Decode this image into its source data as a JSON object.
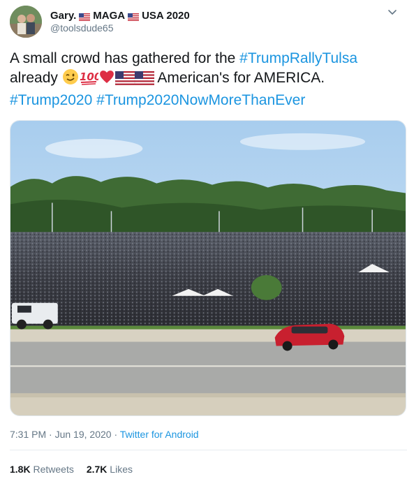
{
  "author": {
    "name": "Gary.",
    "badge1": "MAGA",
    "badge2": "USA 2020",
    "handle": "@toolsdude65"
  },
  "tweet": {
    "text_part1": "A small crowd has gathered for the ",
    "hashtag_rally": "#TrumpRallyTulsa",
    "text_part2": "already",
    "text_part3": " American's for AMERICA.",
    "hashtag_trump2020": "#Trump2020",
    "hashtag_nmte": "#Trump2020NowMoreThanEver"
  },
  "meta": {
    "time": "7:31 PM",
    "sep1": " · ",
    "date": "Jun 19, 2020",
    "sep2": " · ",
    "source": "Twitter for Android"
  },
  "stats": {
    "retweets_count": "1.8K",
    "retweets_label": "Retweets",
    "likes_count": "2.7K",
    "likes_label": "Likes"
  },
  "icons": {
    "menu": "chevron-down-icon",
    "flag": "us-flag-icon",
    "wink": "winking-face-icon",
    "hundred": "hundred-points-icon",
    "heart": "red-heart-icon"
  },
  "colors": {
    "link": "#1b95e0",
    "secondary": "#657786",
    "heart": "#e0245e"
  }
}
